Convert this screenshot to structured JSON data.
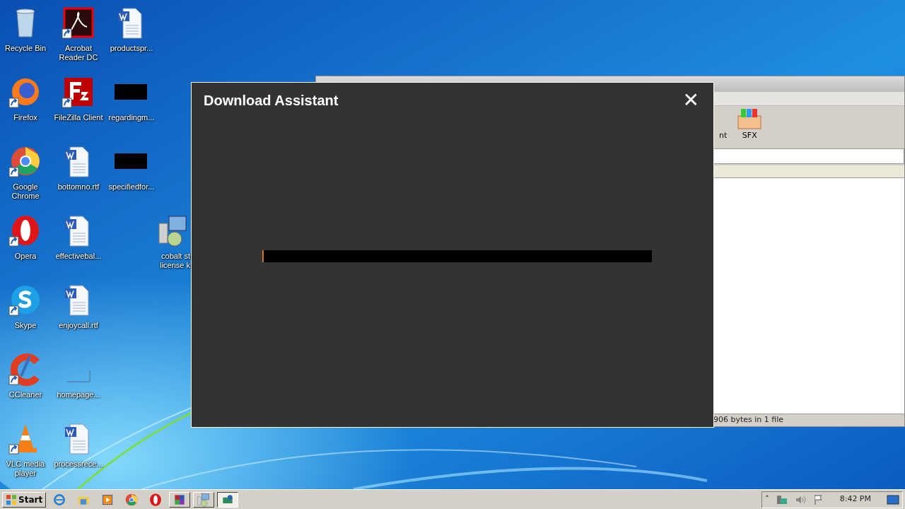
{
  "desktop_icons": [
    {
      "kind": "recycle",
      "lines": [
        "Recycle Bin"
      ],
      "shortcut": false
    },
    {
      "kind": "firefox",
      "lines": [
        "Firefox"
      ],
      "shortcut": true
    },
    {
      "kind": "chrome",
      "lines": [
        "Google",
        "Chrome"
      ],
      "shortcut": true
    },
    {
      "kind": "opera",
      "lines": [
        "Opera"
      ],
      "shortcut": true
    },
    {
      "kind": "skype",
      "lines": [
        "Skype"
      ],
      "shortcut": true
    },
    {
      "kind": "ccleaner",
      "lines": [
        "CCleaner"
      ],
      "shortcut": true
    },
    {
      "kind": "vlc",
      "lines": [
        "VLC media",
        "player"
      ],
      "shortcut": true
    },
    {
      "kind": "acrobat",
      "lines": [
        "Acrobat",
        "Reader DC"
      ],
      "shortcut": true
    },
    {
      "kind": "filezilla",
      "lines": [
        "FileZilla Client"
      ],
      "shortcut": true
    },
    {
      "kind": "word",
      "lines": [
        "bottomno.rtf"
      ],
      "shortcut": false
    },
    {
      "kind": "word",
      "lines": [
        "effectivebal..."
      ],
      "shortcut": false
    },
    {
      "kind": "word",
      "lines": [
        "enjoycall.rtf"
      ],
      "shortcut": false
    },
    {
      "kind": "blank",
      "lines": [
        "homepage..."
      ],
      "shortcut": false
    },
    {
      "kind": "word",
      "lines": [
        "processrece..."
      ],
      "shortcut": false
    },
    {
      "kind": "word",
      "lines": [
        "productspr..."
      ],
      "shortcut": false
    },
    {
      "kind": "redacted",
      "lines": [
        "regardingm..."
      ],
      "shortcut": false
    },
    {
      "kind": "redacted",
      "lines": [
        "specifiedfor..."
      ],
      "shortcut": false
    },
    {
      "kind": "installer",
      "lines": [
        "cobalt st",
        "license k"
      ],
      "shortcut": false
    }
  ],
  "background_window": {
    "toolbar": [
      {
        "label": "nt"
      },
      {
        "label": "SFX"
      }
    ],
    "status_bar": "906 bytes in 1 file"
  },
  "dialog": {
    "title": "Download Assistant",
    "close": "✕",
    "progress": {
      "level": 0.004
    }
  },
  "taskbar": {
    "start": "Start",
    "items": [
      {
        "kind": "ie",
        "active": false,
        "button": false
      },
      {
        "kind": "folder",
        "active": false,
        "button": false
      },
      {
        "kind": "media",
        "active": false,
        "button": false
      },
      {
        "kind": "chrome",
        "active": false,
        "button": false
      },
      {
        "kind": "opera",
        "active": false,
        "button": false
      },
      {
        "kind": "winrar",
        "active": false,
        "button": true
      },
      {
        "kind": "installer",
        "active": false,
        "button": true
      },
      {
        "kind": "app",
        "active": true,
        "button": true
      }
    ],
    "tray": {
      "expand": "˄",
      "clock": "8:42 PM"
    }
  }
}
